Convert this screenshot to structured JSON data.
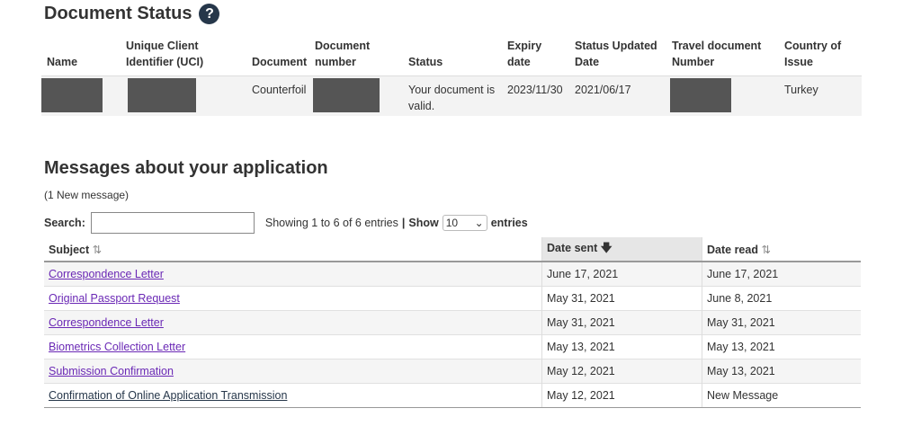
{
  "status_section": {
    "title": "Document Status",
    "help_icon": "?",
    "headers": [
      "Name",
      "Unique Client Identifier (UCI)",
      "Document",
      "Document number",
      "Status",
      "Expiry date",
      "Status Updated Date",
      "Travel document Number",
      "Country of Issue"
    ],
    "row": {
      "document": "Counterfoil",
      "status": "Your document is valid.",
      "expiry": "2023/11/30",
      "updated": "2021/06/17",
      "country": "Turkey"
    }
  },
  "messages_section": {
    "title": "Messages about your application",
    "new_count": "(1 New message)",
    "search_label": "Search:",
    "search_value": "",
    "showing": "Showing 1 to 6 of 6 entries",
    "show_label": "Show",
    "show_value": "10",
    "entries_label": "entries",
    "columns": {
      "subject": "Subject",
      "date_sent": "Date sent",
      "date_read": "Date read"
    },
    "rows": [
      {
        "subject": "Correspondence Letter",
        "sent": "June 17, 2021",
        "read": "June 17, 2021"
      },
      {
        "subject": "Original Passport Request",
        "sent": "May 31, 2021",
        "read": "June 8, 2021"
      },
      {
        "subject": "Correspondence Letter",
        "sent": "May 31, 2021",
        "read": "May 31, 2021"
      },
      {
        "subject": "Biometrics Collection Letter",
        "sent": "May 13, 2021",
        "read": "May 13, 2021"
      },
      {
        "subject": "Submission Confirmation",
        "sent": "May 12, 2021",
        "read": "May 13, 2021"
      },
      {
        "subject": "Confirmation of Online Application Transmission",
        "sent": "May 12, 2021",
        "read": "New Message"
      }
    ]
  },
  "colors": {
    "link": "#6a28b5",
    "help_bg": "#26374a",
    "redaction": "#555555"
  }
}
